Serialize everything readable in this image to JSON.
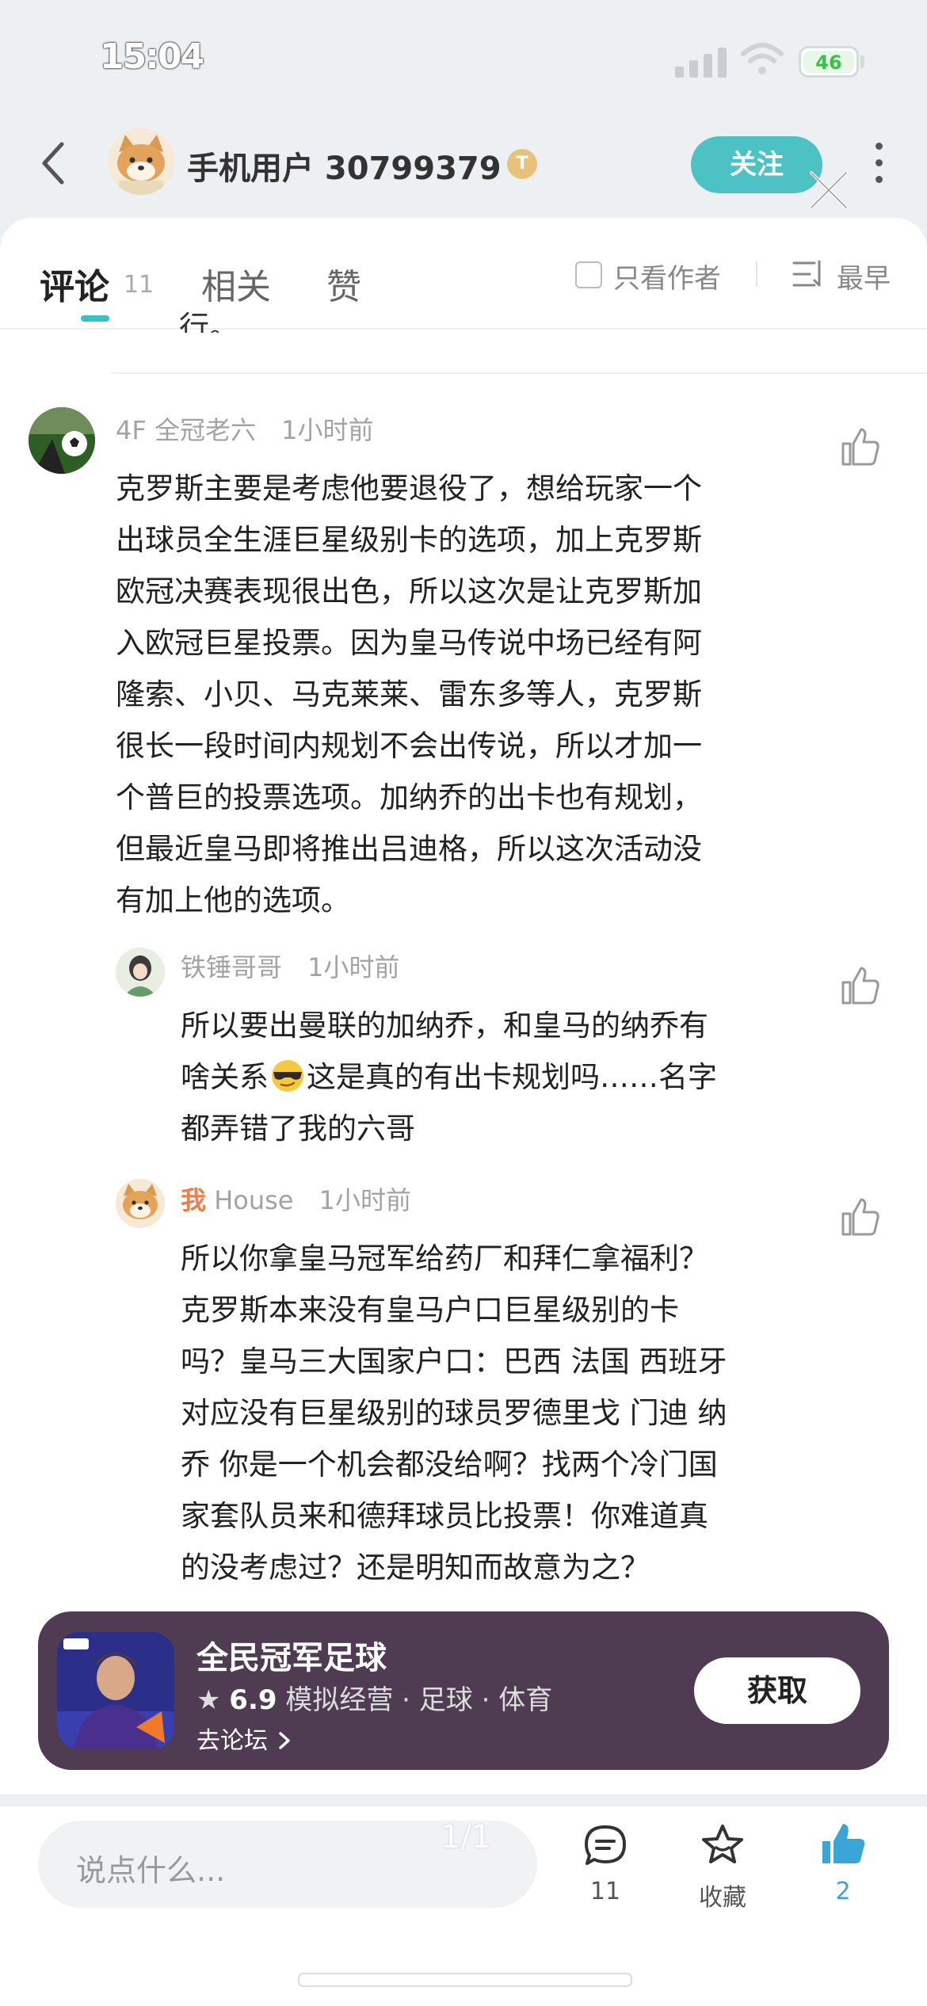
{
  "status_bar": {
    "time": "15:04",
    "battery": "46"
  },
  "header": {
    "user_name": "手机用户 30799379",
    "badge": "T",
    "follow_label": "关注"
  },
  "tabs": {
    "items": [
      {
        "label": "评论",
        "count": "11"
      },
      {
        "label": "相关"
      },
      {
        "label": "赞"
      }
    ],
    "only_author_label": "只看作者",
    "sort_label": "最早"
  },
  "prev_comment_tail": "行。",
  "comments": [
    {
      "floor": "4F",
      "author": "全冠老六",
      "time": "1小时前",
      "lines": [
        "克罗斯主要是考虑他要退役了，想给玩家一个",
        "出球员全生涯巨星级别卡的选项，加上克罗斯",
        "欧冠决赛表现很出色，所以这次是让克罗斯加",
        "入欧冠巨星投票。因为皇马传说中场已经有阿",
        "隆索、小贝、马克莱莱、雷东多等人，克罗斯",
        "很长一段时间内规划不会出传说，所以才加一",
        "个普巨的投票选项。加纳乔的出卡也有规划，",
        "但最近皇马即将推出吕迪格，所以这次活动没",
        "有加上他的选项。"
      ],
      "replies": [
        {
          "author": "铁锤哥哥",
          "time": "1小时前",
          "lines": [
            "所以要出曼联的加纳乔，和皇马的纳乔有",
            "啥关系",
            "这是真的有出卡规划吗……名字",
            "都弄错了我的六哥"
          ]
        },
        {
          "me_tag": "我",
          "author": "House",
          "time": "1小时前",
          "lines": [
            "所以你拿皇马冠军给药厂和拜仁拿福利？",
            "克罗斯本来没有皇马户口巨星级别的卡",
            "吗？皇马三大国家户口：巴西 法国 西班牙",
            "对应没有巨星级别的球员罗德里戈 门迪 纳",
            "乔 你是一个机会都没给啊？找两个冷门国",
            "家套队员来和德拜球员比投票！你难道真",
            "的没考虑过？还是明知而故意为之？"
          ]
        }
      ]
    }
  ],
  "app_card": {
    "name": "全民冠军足球",
    "rating": "6.9",
    "tags": "模拟经营 · 足球 · 体育",
    "forum_link": "去论坛",
    "get_label": "获取"
  },
  "bottom_bar": {
    "input_placeholder": "说点什么...",
    "page_indicator": "1/1",
    "comment_count": "11",
    "favorite_label": "收藏",
    "like_count": "2"
  },
  "colors": {
    "accent": "#4cc2c4",
    "like_active": "#3aa6d8",
    "me_tag": "#ef7d4a",
    "app_card_bg": "#4f3b52"
  }
}
